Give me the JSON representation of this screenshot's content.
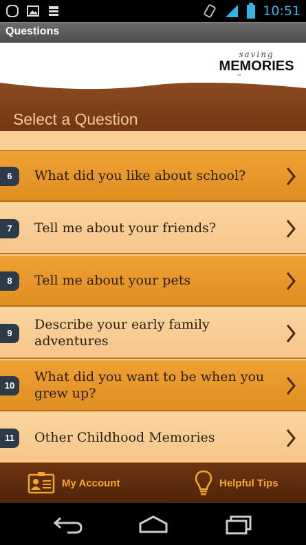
{
  "status_bar": {
    "time": "10:51"
  },
  "title_bar": {
    "title": "Questions"
  },
  "logo": {
    "line1": "saving",
    "line2": "MEMORIES",
    "line3": "forever"
  },
  "section": {
    "title": "Select a Question"
  },
  "questions": [
    {
      "number": "6",
      "text": "What did you like about school?"
    },
    {
      "number": "7",
      "text": "Tell me about your friends?"
    },
    {
      "number": "8",
      "text": "Tell me about your pets"
    },
    {
      "number": "9",
      "text": "Describe your early family adventures"
    },
    {
      "number": "10",
      "text": "What did you want to be when you grew up?"
    },
    {
      "number": "11",
      "text": "Other Childhood Memories"
    }
  ],
  "bottom_bar": {
    "account_label": "My Account",
    "tips_label": "Helpful Tips"
  },
  "colors": {
    "accent": "#f3a928",
    "row_dark": "#e8962a",
    "row_light": "#f8cd94",
    "badge": "#2d3a48",
    "wood": "#6f3512"
  }
}
